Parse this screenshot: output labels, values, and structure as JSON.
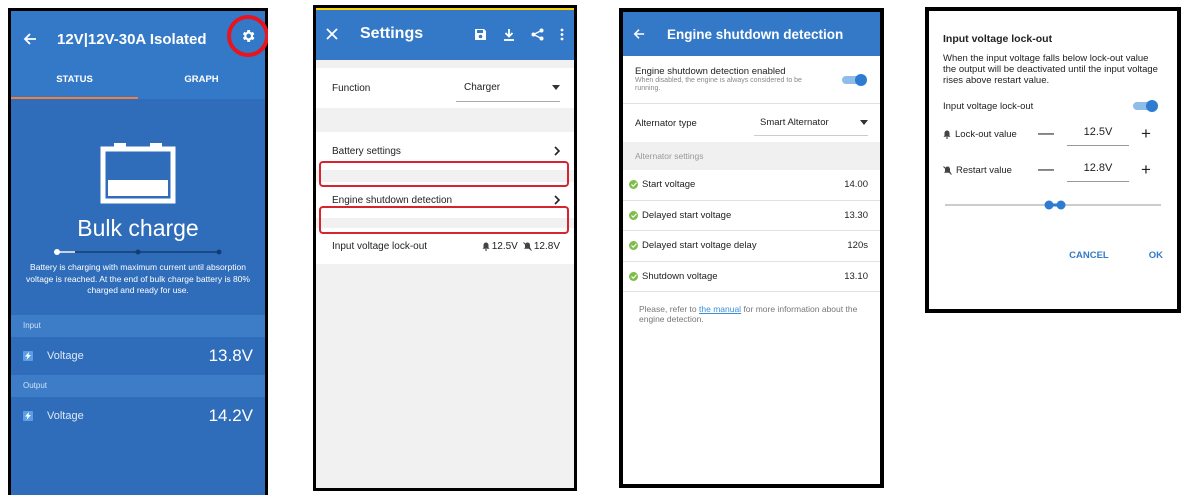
{
  "colors": {
    "brand_blue": "#3479c8",
    "highlight_red": "#d62531",
    "ok_green": "#7fbe4a",
    "tab_accent": "#f47f3a"
  },
  "status_screen": {
    "title": "12V|12V-30A Isolated",
    "tabs": [
      {
        "label": "STATUS",
        "active": true
      },
      {
        "label": "GRAPH",
        "active": false
      }
    ],
    "state": "Bulk charge",
    "description": "Battery is charging with maximum current until absorption voltage is reached. At the end of bulk charge battery is  80% charged and ready for use.",
    "input_section": "Input",
    "output_section": "Output",
    "input": {
      "label": "Voltage",
      "value": "13.8V"
    },
    "output": {
      "label": "Voltage",
      "value": "14.2V"
    },
    "icons": [
      "back-arrow-icon",
      "gear-icon",
      "battery-icon",
      "lightning-icon"
    ]
  },
  "settings_screen": {
    "title": "Settings",
    "function": {
      "label": "Function",
      "value": "Charger"
    },
    "items": [
      {
        "label": "Battery settings"
      },
      {
        "label": "Engine shutdown detection",
        "highlighted": true
      },
      {
        "label": "Input voltage lock-out",
        "highlighted": true,
        "lockout": "12.5V",
        "restart": "12.8V"
      }
    ],
    "icons": [
      "close-icon",
      "save-icon",
      "download-icon",
      "share-icon",
      "more-icon"
    ]
  },
  "engine_screen": {
    "title": "Engine shutdown detection",
    "enabled": {
      "label": "Engine shutdown detection enabled",
      "sub": "When disabled, the engine is always considered to be running.",
      "on": true
    },
    "alternator": {
      "label": "Alternator type",
      "value": "Smart Alternator"
    },
    "section": "Alternator settings",
    "rows": [
      {
        "label": "Start voltage",
        "value": "14.00"
      },
      {
        "label": "Delayed start voltage",
        "value": "13.30"
      },
      {
        "label": "Delayed start voltage delay",
        "value": "120s"
      },
      {
        "label": "Shutdown voltage",
        "value": "13.10"
      }
    ],
    "footer_pre": "Please, refer to ",
    "footer_link": "the manual",
    "footer_post": " for more information about the engine detection."
  },
  "lockout_dialog": {
    "title": "Input voltage lock-out",
    "text": "When the input voltage falls below lock-out value the output will be deactivated until the input voltage rises above restart value.",
    "toggle": {
      "label": "Input voltage lock-out",
      "on": true
    },
    "lockout": {
      "label": "Lock-out value",
      "value": "12.5V"
    },
    "restart": {
      "label": "Restart value",
      "value": "12.8V"
    },
    "cancel": "CANCEL",
    "ok": "OK"
  }
}
